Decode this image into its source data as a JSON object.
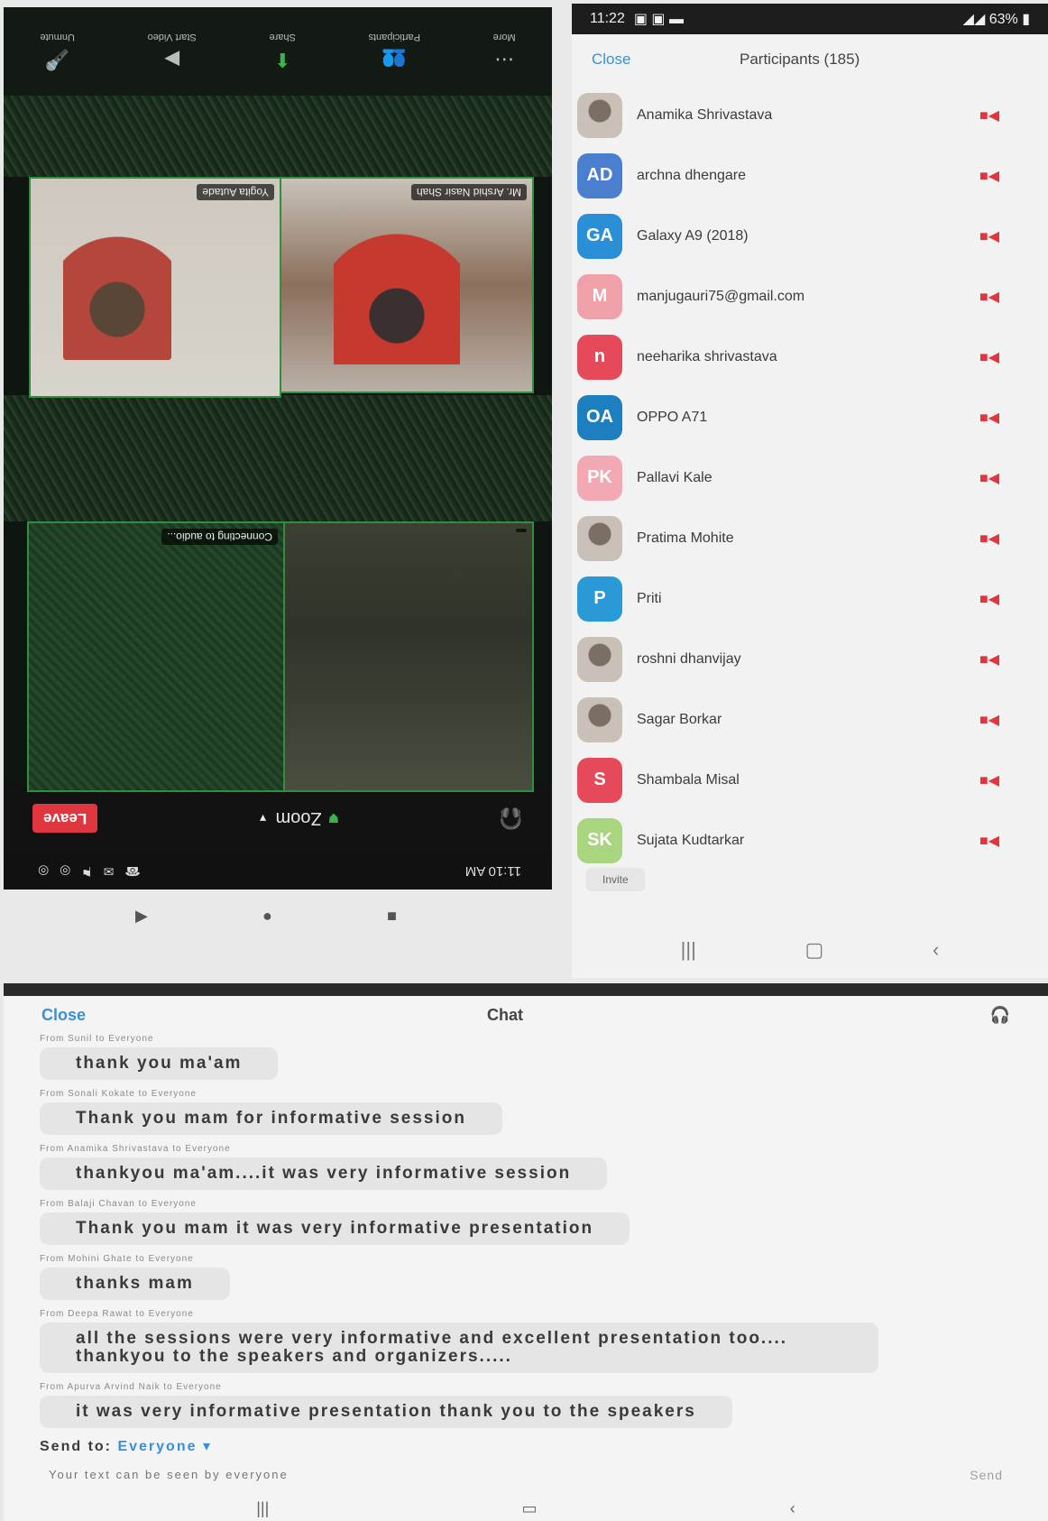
{
  "meeting": {
    "status_time": "11:10 AM",
    "status_icons": "☎ ✉ ⚑ ◎ ◎",
    "leave_label": "Leave",
    "title": "Zoom",
    "tiles": [
      {
        "name": "Yogita Autade"
      },
      {
        "name": "Mr. Arshid Nasir Shah"
      },
      {
        "name": "Connecting to audio..."
      },
      {
        "name": ""
      }
    ],
    "toolbar": [
      {
        "label": "Unmute",
        "icon": "mic-icon"
      },
      {
        "label": "Start Video",
        "icon": "video-icon"
      },
      {
        "label": "Share",
        "icon": "share-icon"
      },
      {
        "label": "Participants",
        "icon": "participants-icon"
      },
      {
        "label": "More",
        "icon": "more-icon"
      }
    ]
  },
  "participants": {
    "status_time": "11:22",
    "battery": "63%",
    "close_label": "Close",
    "title": "Participants (185)",
    "invite_label": "Invite",
    "items": [
      {
        "name": "Anamika Shrivastava",
        "initials": "",
        "color": "#c9c1b7"
      },
      {
        "name": "archna dhengare",
        "initials": "AD",
        "color": "#4a7fcf"
      },
      {
        "name": "Galaxy A9 (2018)",
        "initials": "GA",
        "color": "#2a8fd6"
      },
      {
        "name": "manjugauri75@gmail.com",
        "initials": "M",
        "color": "#f0a0a8"
      },
      {
        "name": "neeharika shrivastava",
        "initials": "n",
        "color": "#e64a5a"
      },
      {
        "name": "OPPO A71",
        "initials": "OA",
        "color": "#1d7fbf"
      },
      {
        "name": "Pallavi Kale",
        "initials": "PK",
        "color": "#f2a9b4"
      },
      {
        "name": "Pratima Mohite",
        "initials": "",
        "color": "#c9c1b7"
      },
      {
        "name": "Priti",
        "initials": "P",
        "color": "#2a9ad6"
      },
      {
        "name": "roshni dhanvijay",
        "initials": "",
        "color": "#c9c1b7"
      },
      {
        "name": "Sagar Borkar",
        "initials": "",
        "color": "#c9c1b7"
      },
      {
        "name": "Shambala Misal",
        "initials": "S",
        "color": "#e64a5a"
      },
      {
        "name": "Sujata Kudtarkar",
        "initials": "SK",
        "color": "#a9d57f"
      }
    ]
  },
  "chat": {
    "close_label": "Close",
    "title": "Chat",
    "messages": [
      {
        "from": "From Sunil to Everyone",
        "text": "thank you ma'am"
      },
      {
        "from": "From Sonali Kokate to Everyone",
        "text": "Thank you mam for informative session"
      },
      {
        "from": "From Anamika Shrivastava to Everyone",
        "text": "thankyou ma'am....it was very informative session"
      },
      {
        "from": "From Balaji Chavan to Everyone",
        "text": "Thank you mam it was very informative presentation"
      },
      {
        "from": "From Mohini Ghate to Everyone",
        "text": "thanks mam"
      },
      {
        "from": "From Deepa Rawat to Everyone",
        "text": "all the sessions were very informative and excellent presentation too.... thankyou to the speakers and organizers....."
      },
      {
        "from": "From Apurva Arvind Naik to Everyone",
        "text": "it was very informative presentation thank you to the speakers"
      }
    ],
    "send_to_label": "Send to:",
    "send_to_target": "Everyone",
    "input_placeholder": "Your text can be seen by everyone",
    "send_label": "Send"
  }
}
